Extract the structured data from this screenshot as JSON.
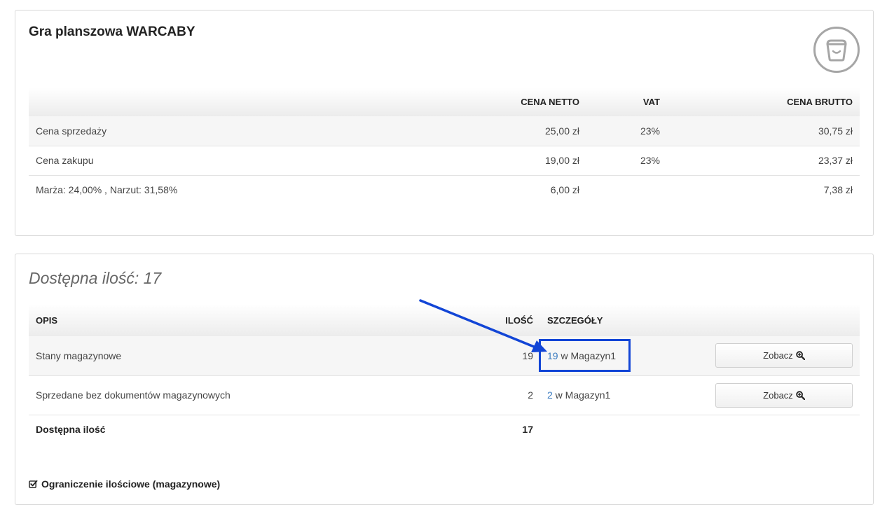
{
  "product": {
    "title": "Gra planszowa WARCABY",
    "icon": "shopping-basket-icon"
  },
  "price_table": {
    "headers": [
      "",
      "CENA NETTO",
      "VAT",
      "CENA BRUTTO"
    ],
    "rows": [
      {
        "label": "Cena sprzedaży",
        "netto": "25,00 zł",
        "vat": "23%",
        "brutto": "30,75 zł"
      },
      {
        "label": "Cena zakupu",
        "netto": "19,00 zł",
        "vat": "23%",
        "brutto": "23,37 zł"
      },
      {
        "label": "Marża: 24,00% , Narzut: 31,58%",
        "netto": "6,00 zł",
        "vat": "",
        "brutto": "7,38 zł"
      }
    ]
  },
  "stock": {
    "title": "Dostępna ilość: 17",
    "headers": [
      "OPIS",
      "ILOŚĆ",
      "SZCZEGÓŁY",
      ""
    ],
    "rows": [
      {
        "opis": "Stany magazynowe",
        "ilosc": "19",
        "details_qty": "19",
        "details_text": " w Magazyn1",
        "button": "Zobacz"
      },
      {
        "opis": "Sprzedane bez dokumentów magazynowych",
        "ilosc": "2",
        "details_qty": "2",
        "details_text": " w Magazyn1",
        "button": "Zobacz"
      }
    ],
    "total": {
      "label": "Dostępna ilość",
      "value": "17"
    }
  },
  "restriction": {
    "label": "Ograniczenie ilościowe (magazynowe)",
    "checked": true
  },
  "colors": {
    "annotation": "#1245d6",
    "link": "#3a7bc0"
  }
}
